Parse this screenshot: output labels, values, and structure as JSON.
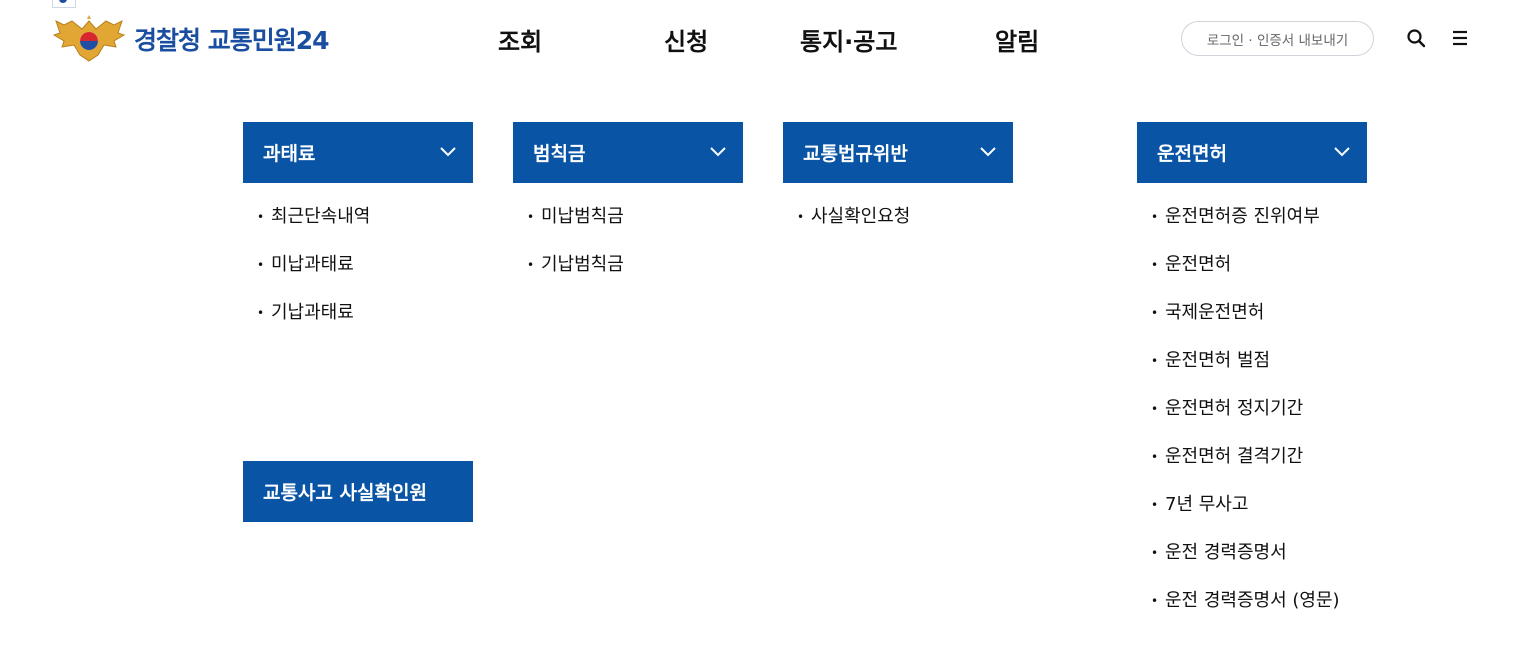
{
  "header": {
    "logo_text": "경찰청 교통민원24",
    "nav": [
      "조회",
      "신청",
      "통지·공고",
      "알림"
    ],
    "login_label": "로그인 · 인증서 내보내기",
    "search_icon": "search-icon",
    "menu_icon": "hamburger-menu-icon"
  },
  "mega_menu": {
    "columns": [
      {
        "title": "과태료",
        "items": [
          "최근단속내역",
          "미납과태료",
          "기납과태료"
        ]
      },
      {
        "title": "범칙금",
        "items": [
          "미납범칙금",
          "기납범칙금"
        ]
      },
      {
        "title": "교통법규위반",
        "items": [
          "사실확인요청"
        ]
      },
      {
        "title": "운전면허",
        "items": [
          "운전면허증 진위여부",
          "운전면허",
          "국제운전면허",
          "운전면허 벌점",
          "운전면허 정지기간",
          "운전면허 결격기간",
          "7년 무사고",
          "운전 경력증명서",
          "운전 경력증명서 (영문)"
        ]
      }
    ],
    "extra_box": "교통사고 사실확인원"
  },
  "colors": {
    "brand_blue": "#0a54a5",
    "logo_blue": "#1a4ea1"
  }
}
